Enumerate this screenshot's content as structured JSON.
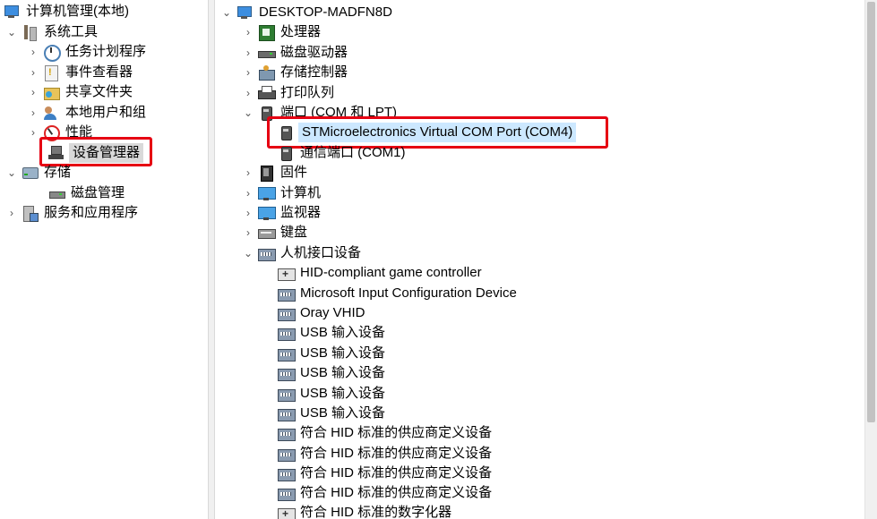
{
  "left_tree": {
    "root": "计算机管理(本地)",
    "system_tools": "系统工具",
    "task_scheduler": "任务计划程序",
    "event_viewer": "事件查看器",
    "shared_folders": "共享文件夹",
    "local_users": "本地用户和组",
    "performance": "性能",
    "device_manager": "设备管理器",
    "storage": "存储",
    "disk_management": "磁盘管理",
    "services_apps": "服务和应用程序"
  },
  "device_tree": {
    "computer_name": "DESKTOP-MADFN8D",
    "processors": "处理器",
    "disk_drives": "磁盘驱动器",
    "storage_controllers": "存储控制器",
    "print_queues": "打印队列",
    "ports": "端口 (COM 和 LPT)",
    "stm_port": "STMicroelectronics Virtual COM Port (COM4)",
    "comm_port": "通信端口 (COM1)",
    "firmware": "固件",
    "computer": "计算机",
    "monitors": "监视器",
    "keyboards": "键盘",
    "hid": "人机接口设备",
    "hid_items": [
      "HID-compliant game controller",
      "Microsoft Input Configuration Device",
      "Oray VHID",
      "USB 输入设备",
      "USB 输入设备",
      "USB 输入设备",
      "USB 输入设备",
      "USB 输入设备",
      "符合 HID 标准的供应商定义设备",
      "符合 HID 标准的供应商定义设备",
      "符合 HID 标准的供应商定义设备",
      "符合 HID 标准的供应商定义设备",
      "符合 HID 标准的数字化器"
    ]
  },
  "colors": {
    "highlight_frame": "#e60012",
    "selection": "#cce8ff"
  }
}
